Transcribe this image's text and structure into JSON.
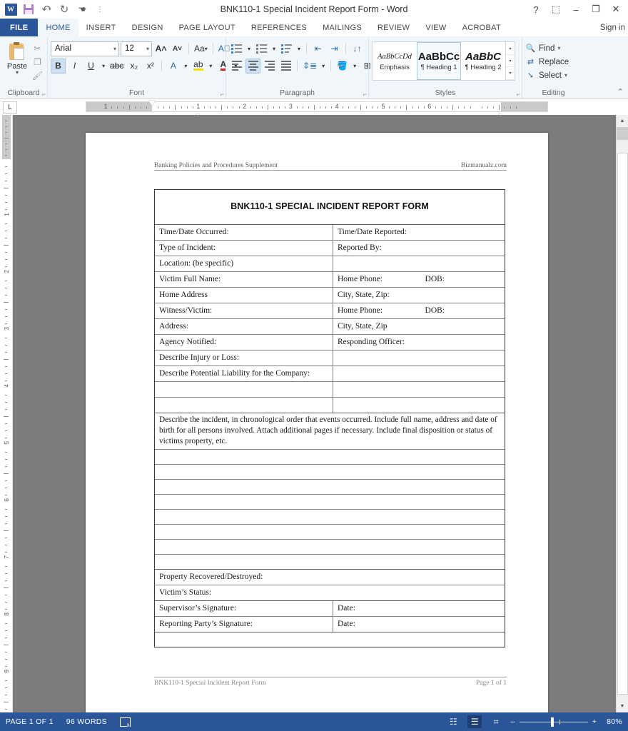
{
  "window": {
    "title": "BNK110-1 Special Incident Report Form - Word",
    "quick_access": [
      {
        "name": "word-logo",
        "glyph": "W"
      },
      {
        "name": "save-icon",
        "glyph": ""
      },
      {
        "name": "undo-icon",
        "glyph": "↶"
      },
      {
        "name": "redo-icon",
        "glyph": "↻"
      },
      {
        "name": "touch-mode-icon",
        "glyph": "☚"
      },
      {
        "name": "customize-qat-icon",
        "glyph": "⋮"
      }
    ],
    "buttons": {
      "help": "?",
      "ribbon_display": "⬚",
      "minimize": "–",
      "maximize": "❐",
      "close": "✕"
    }
  },
  "ribbon": {
    "tabs": [
      {
        "label": "FILE",
        "active": false,
        "file": true
      },
      {
        "label": "HOME",
        "active": true
      },
      {
        "label": "INSERT",
        "active": false
      },
      {
        "label": "DESIGN",
        "active": false
      },
      {
        "label": "PAGE LAYOUT",
        "active": false
      },
      {
        "label": "REFERENCES",
        "active": false
      },
      {
        "label": "MAILINGS",
        "active": false
      },
      {
        "label": "REVIEW",
        "active": false
      },
      {
        "label": "VIEW",
        "active": false
      },
      {
        "label": "ACROBAT",
        "active": false
      }
    ],
    "sign_in": "Sign in",
    "groups": {
      "clipboard": {
        "label": "Clipboard",
        "paste_label": "Paste",
        "items": [
          "cut",
          "copy",
          "format-painter"
        ]
      },
      "font": {
        "label": "Font",
        "font_name": "Arial",
        "font_size": "12",
        "bold_active": true
      },
      "paragraph": {
        "label": "Paragraph",
        "align_center_active": true
      },
      "styles": {
        "label": "Styles",
        "items": [
          {
            "preview": "AaBbCcDd",
            "name": "Emphasis",
            "selected": false
          },
          {
            "preview": "AaBbCc",
            "name": "¶ Heading 1",
            "selected": true
          },
          {
            "preview": "AaBbC",
            "name": "¶ Heading 2",
            "selected": false
          }
        ]
      },
      "editing": {
        "label": "Editing",
        "find": "Find",
        "replace": "Replace",
        "select": "Select"
      }
    }
  },
  "ruler": {
    "tab_stop_selector": "L",
    "h_labels": [
      "1",
      "1",
      "2",
      "3",
      "4",
      "5"
    ],
    "v_labels": [
      "1",
      "2",
      "3",
      "4",
      "5",
      "6",
      "7",
      "8"
    ]
  },
  "document": {
    "header_left": "Banking Policies and Procedures Supplement",
    "header_right": "Bizmanualz.com",
    "footer_left": "BNK110-1 Special Incident Report Form",
    "footer_right": "Page 1 of 1",
    "form_title": "BNK110-1 SPECIAL INCIDENT REPORT FORM",
    "rows": [
      {
        "left": "Time/Date Occurred:",
        "right": "Time/Date Reported:",
        "split": true
      },
      {
        "left": "Type of Incident:",
        "right": "Reported By:",
        "split": true
      },
      {
        "left": "Location:  (be specific)",
        "right": "",
        "split": true
      },
      {
        "left": "Victim Full Name:",
        "right": "Home Phone:",
        "extra": "DOB:",
        "split": true
      },
      {
        "left": "Home Address",
        "right": "City, State, Zip:",
        "split": true
      },
      {
        "left": "Witness/Victim:",
        "right": "Home Phone:",
        "extra": "DOB:",
        "split": true
      },
      {
        "left": "Address:",
        "right": "City, State, Zip",
        "split": true
      },
      {
        "left": "Agency Notified:",
        "right": "Responding Officer:",
        "split": true
      },
      {
        "left": "Describe Injury or Loss:",
        "right": "",
        "split": true
      },
      {
        "left": "Describe Potential Liability for the Company:",
        "right": "",
        "split": true
      },
      {
        "left": "",
        "right": "",
        "split": true
      },
      {
        "left": "",
        "right": "",
        "split": true
      }
    ],
    "instructions": "Describe the incident, in chronological order that events occurred.  Include full name, address and date of birth for all persons involved.  Attach additional pages if necessary.  Include final disposition or status of victims property, etc.",
    "blank_write_lines": 8,
    "tail_rows": [
      {
        "left": "Property Recovered/Destroyed:",
        "right": "",
        "split": false
      },
      {
        "left": "Victim’s Status:",
        "right": "",
        "split": false
      },
      {
        "left": "Supervisor’s Signature:",
        "right": "Date:",
        "split": true
      },
      {
        "left": "Reporting Party’s Signature:",
        "right": "Date:",
        "split": true
      }
    ]
  },
  "statusbar": {
    "page": "PAGE 1 OF 1",
    "words": "96 WORDS",
    "proofing_icon": "proofing-errors-icon",
    "views": [
      {
        "name": "read-mode-view",
        "glyph": "☷",
        "active": false
      },
      {
        "name": "print-layout-view",
        "glyph": "☰",
        "active": true
      },
      {
        "name": "web-layout-view",
        "glyph": "⌗",
        "active": false
      }
    ],
    "zoom_out": "–",
    "zoom_in": "+",
    "zoom_level": "80%"
  }
}
